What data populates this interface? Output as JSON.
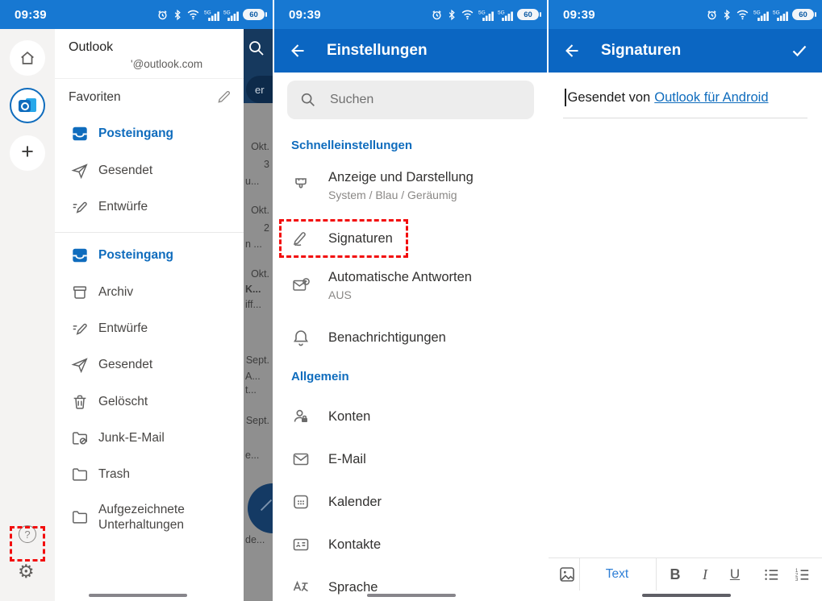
{
  "status_bar": {
    "time": "09:39",
    "battery": "60",
    "icon_names": [
      "alarm-icon",
      "bluetooth-icon",
      "wifi-icon",
      "signal-5g-icon",
      "signal-5g-icon",
      "battery-icon"
    ]
  },
  "colors": {
    "accent": "#0F6CBD",
    "status_bar_blue": "#1778D2",
    "app_bar_blue": "#0B66C2",
    "highlight_red": "#F20D0D",
    "link_blue": "#0F6CBD"
  },
  "drawer": {
    "app_name": "Outlook",
    "account_email": "'@outlook.com",
    "favorites_title": "Favoriten",
    "favorites": [
      {
        "label": "Posteingang",
        "icon": "inbox-icon",
        "active": true
      },
      {
        "label": "Gesendet",
        "icon": "send-icon"
      },
      {
        "label": "Entwürfe",
        "icon": "drafts-icon"
      }
    ],
    "folders": [
      {
        "label": "Posteingang",
        "icon": "inbox-icon",
        "active": true
      },
      {
        "label": "Archiv",
        "icon": "archive-icon"
      },
      {
        "label": "Entwürfe",
        "icon": "drafts-icon"
      },
      {
        "label": "Gesendet",
        "icon": "send-icon"
      },
      {
        "label": "Gelöscht",
        "icon": "trash-icon"
      },
      {
        "label": "Junk-E-Mail",
        "icon": "junk-folder-icon"
      },
      {
        "label": "Trash",
        "icon": "folder-icon"
      },
      {
        "label": "Aufgezeichnete Unterhaltungen",
        "icon": "folder-icon"
      }
    ]
  },
  "inbox_backdrop": {
    "filter_fragment": "er",
    "fragments": [
      "Okt.",
      "3",
      "u...",
      "Okt.",
      "2",
      "n ...",
      "Okt.",
      "K...",
      "iff...",
      "Sept.",
      "A...",
      "t...",
      "Sept.",
      "e...",
      "de..."
    ]
  },
  "settings": {
    "title": "Einstellungen",
    "search_placeholder": "Suchen",
    "quick_section_title": "Schnelleinstellungen",
    "appearance_label": "Anzeige und Darstellung",
    "appearance_subtitle": "System / Blau / Geräumig",
    "signatures_label": "Signaturen",
    "auto_reply_label": "Automatische Antworten",
    "auto_reply_subtitle": "AUS",
    "notifications_label": "Benachrichtigungen",
    "general_section_title": "Allgemein",
    "accounts_label": "Konten",
    "email_label": "E-Mail",
    "calendar_label": "Kalender",
    "contacts_label": "Kontakte",
    "language_label": "Sprache"
  },
  "signature_editor": {
    "title": "Signaturen",
    "body_text": "Gesendet von",
    "body_link": "Outlook für Android",
    "toolbar": {
      "image_icon": "image-icon",
      "text_label": "Text",
      "bold_label": "B",
      "italic_label": "I",
      "underline_label": "U",
      "list_icons": [
        "bullet-list-icon",
        "numbered-list-icon"
      ]
    }
  }
}
